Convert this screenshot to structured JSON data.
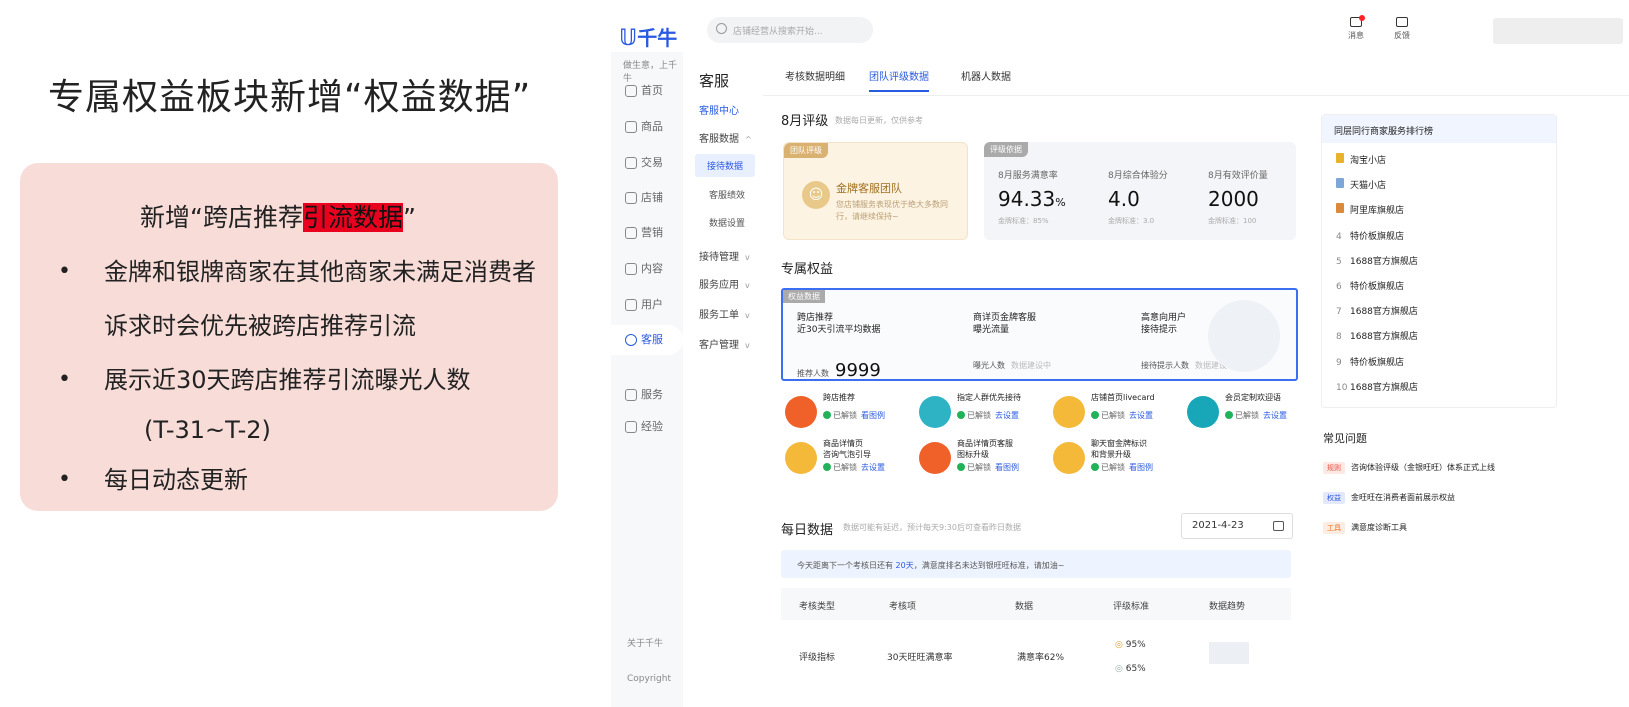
{
  "slide": {
    "title": "专属权益板块新增“权益数据”",
    "note": {
      "head_plain": "新增“跨店推荐",
      "head_highlight": "引流数据",
      "head_tail": "”",
      "bullet": "•",
      "items": [
        "金牌和银牌商家在其他商家未满足消费者诉求时会优先被跨店推荐引流",
        "展示近30天跨店推荐引流曝光人数",
        "每日动态更新"
      ],
      "sub_line": "(T-31~T-2)"
    }
  },
  "app": {
    "logo": "千牛",
    "logo_sub": "做生意，上千牛",
    "search_placeholder": "店铺经营从搜索开始...",
    "topbar": {
      "message": "消息",
      "feedback": "反馈"
    },
    "sidebar": {
      "items": [
        "首页",
        "商品",
        "交易",
        "店铺",
        "营销",
        "内容",
        "用户",
        "客服",
        "服务",
        "经验"
      ],
      "active": "客服",
      "footer": [
        "关于千牛",
        "Copyright"
      ]
    },
    "subnav": {
      "title": "客服",
      "center": "客服中心",
      "data_group": "客服数据",
      "children": [
        "接待数据",
        "客服绩效",
        "数据设置"
      ],
      "groups": [
        "接待管理",
        "服务应用",
        "服务工单",
        "客户管理"
      ]
    },
    "tabs": [
      "考核数据明细",
      "团队评级数据",
      "机器人数据"
    ],
    "active_tab": "团队评级数据",
    "rating": {
      "title": "8月评级",
      "title_note": "数据每日更新，仅供参考",
      "team_tag": "团队评级",
      "team_name": "金牌客服团队",
      "team_desc": "您店铺服务表现优于绝大多数同行，请继续保持~",
      "metrics_tag": "评级依据",
      "metrics": [
        {
          "label": "8月服务满意率",
          "value": "94.33",
          "unit": "%",
          "std": "金牌标准：85%"
        },
        {
          "label": "8月综合体验分",
          "value": "4.0",
          "unit": "",
          "std": "金牌标准：3.0"
        },
        {
          "label": "8月有效评价量",
          "value": "2000",
          "unit": "",
          "std": "金牌标准：100"
        }
      ]
    },
    "equity": {
      "title": "专属权益",
      "tag": "权益数据",
      "cols": [
        {
          "title": "跨店推荐\n近30天引流平均数据",
          "label": "推荐人数",
          "value": "9999",
          "pending": ""
        },
        {
          "title": "商详页金牌客服\n曝光流量",
          "label": "曝光人数",
          "value": "",
          "pending": "数据建设中"
        },
        {
          "title": "高意向用户\n接待提示",
          "label": "接待提示人数",
          "value": "",
          "pending": "数据建设中"
        }
      ],
      "unlocked": "已解锁",
      "benefits": [
        {
          "name": "跨店推荐",
          "link": "看图例",
          "color": "#f0612a"
        },
        {
          "name": "指定人群优先接待",
          "link": "去设置",
          "color": "#2db3c4"
        },
        {
          "name": "店铺首页livecard",
          "link": "去设置",
          "color": "#f5b93a"
        },
        {
          "name": "会员定制欢迎语",
          "link": "去设置",
          "color": "#18a7b8"
        },
        {
          "name": "商品详情页\n咨询气泡引导",
          "link": "去设置",
          "color": "#f5b93a"
        },
        {
          "name": "商品详情页客服\n图标升级",
          "link": "看图例",
          "color": "#f0612a"
        },
        {
          "name": "聊天窗金牌标识\n和背景升级",
          "link": "看图例",
          "color": "#f5b93a"
        }
      ]
    },
    "daily": {
      "title": "每日数据",
      "note": "数据可能有延迟，预计每天9:30后可查看昨日数据",
      "date": "2021-4-23",
      "alert_pre": "今天距离下一个考核日还有 ",
      "alert_num": "20天",
      "alert_post": "，满意度排名未达到银旺旺标准，请加油~",
      "headers": [
        "考核类型",
        "考核项",
        "数据",
        "评级标准",
        "数据趋势"
      ],
      "row": {
        "type": "评级指标",
        "item": "30天旺旺满意率",
        "data": "满意率62%",
        "std1": "95%",
        "std2": "65%"
      }
    },
    "rank": {
      "title": "同层同行商家服务排行榜",
      "items": [
        "淘宝小店",
        "天猫小店",
        "阿里库旗舰店",
        "特价板旗舰店",
        "1688官方旗舰店",
        "特价板旗舰店",
        "1688官方旗舰店",
        "1688官方旗舰店",
        "特价板旗舰店",
        "1688官方旗舰店"
      ],
      "ranks": [
        "1",
        "2",
        "3",
        "4",
        "5",
        "6",
        "7",
        "8",
        "9",
        "10"
      ]
    },
    "faq": {
      "title": "常见问题",
      "items": [
        {
          "tag": "规则",
          "text": "咨询体验评级（金银旺旺）体系正式上线",
          "color": "#e8503a"
        },
        {
          "tag": "权益",
          "text": "金旺旺在消费者面前展示权益",
          "color": "#2a5ae0"
        },
        {
          "tag": "工具",
          "text": "满意度诊断工具",
          "color": "#f07020"
        }
      ]
    }
  }
}
